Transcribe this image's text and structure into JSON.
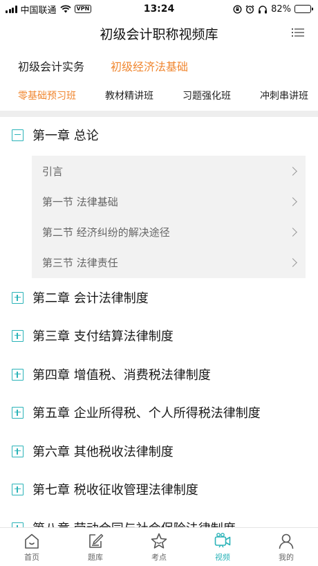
{
  "status_bar": {
    "carrier": "中国联通",
    "vpn": "VPN",
    "time": "13:24",
    "battery": "82%",
    "battery_level": 0.82
  },
  "header": {
    "title": "初级会计职称视频库",
    "menu_icon": "list-menu-icon"
  },
  "subject_tabs": [
    {
      "label": "初级会计实务",
      "active": false
    },
    {
      "label": "初级经济法基础",
      "active": true
    }
  ],
  "class_tabs": [
    {
      "label": "零基础预习班",
      "active": true
    },
    {
      "label": "教材精讲班",
      "active": false
    },
    {
      "label": "习题强化班",
      "active": false
    },
    {
      "label": "冲刺串讲班",
      "active": false
    }
  ],
  "chapters": [
    {
      "title": "第一章 总论",
      "expanded": true,
      "sections": [
        "引言",
        "第一节 法律基础",
        "第二节 经济纠纷的解决途径",
        "第三节 法律责任"
      ]
    },
    {
      "title": "第二章 会计法律制度",
      "expanded": false
    },
    {
      "title": "第三章 支付结算法律制度",
      "expanded": false
    },
    {
      "title": "第四章 增值税、消费税法律制度",
      "expanded": false
    },
    {
      "title": "第五章 企业所得税、个人所得税法律制度",
      "expanded": false
    },
    {
      "title": "第六章 其他税收法律制度",
      "expanded": false
    },
    {
      "title": "第七章 税收征收管理法律制度",
      "expanded": false
    },
    {
      "title": "第八章 劳动合同与社会保险法律制度",
      "expanded": false
    }
  ],
  "bottom_nav": [
    {
      "label": "首页",
      "icon": "home-icon",
      "active": false
    },
    {
      "label": "题库",
      "icon": "edit-icon",
      "active": false
    },
    {
      "label": "考点",
      "icon": "star-icon",
      "active": false
    },
    {
      "label": "视频",
      "icon": "video-camera-icon",
      "active": true
    },
    {
      "label": "我的",
      "icon": "profile-icon",
      "active": false
    }
  ],
  "colors": {
    "accent_orange": "#f0862f",
    "accent_teal": "#2ab3b8"
  }
}
